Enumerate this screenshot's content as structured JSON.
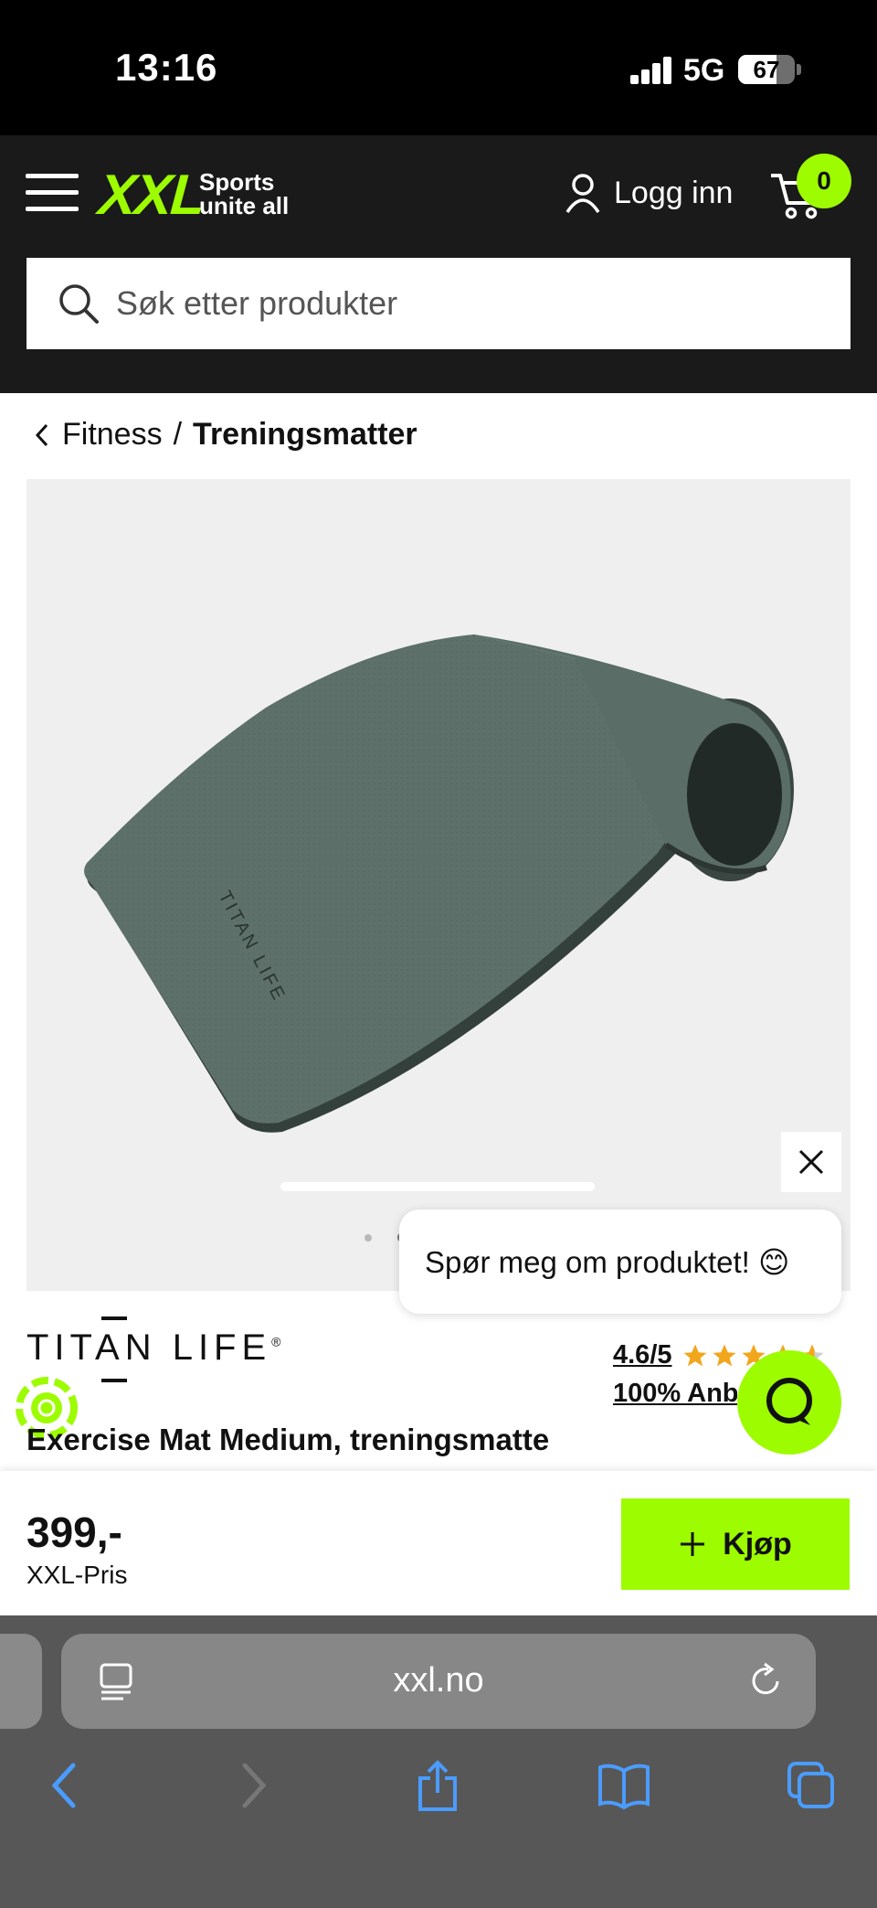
{
  "status_bar": {
    "time": "13:16",
    "network": "5G",
    "battery_percent": "67"
  },
  "header": {
    "logo_text": "XXL",
    "logo_tagline": "Sports unite all",
    "login_label": "Logg inn",
    "cart_count": "0",
    "search_placeholder": "Søk etter produkter",
    "colors": {
      "header_bg": "#1a1a1a",
      "accent": "#9dfc00"
    }
  },
  "breadcrumb": {
    "parent": "Fitness",
    "separator": "/",
    "current": "Treningsmatter"
  },
  "product": {
    "image_alt": "Exercise mat, rolled",
    "image_index": 2,
    "image_count": 2,
    "mat_print": "TITAN LIFE",
    "brand": "TITAN LIFE",
    "rating_score": "4.6/5",
    "rating_stars": 4.6,
    "recommend_text": "100% Anbefaler",
    "title": "Exercise Mat Medium, treningsmatte"
  },
  "chat": {
    "prompt": "Spør meg om produktet! 😊"
  },
  "buy_bar": {
    "price": "399,-",
    "price_label": "XXL-Pris",
    "buy_label": "Kjøp"
  },
  "browser": {
    "url": "xxl.no"
  }
}
